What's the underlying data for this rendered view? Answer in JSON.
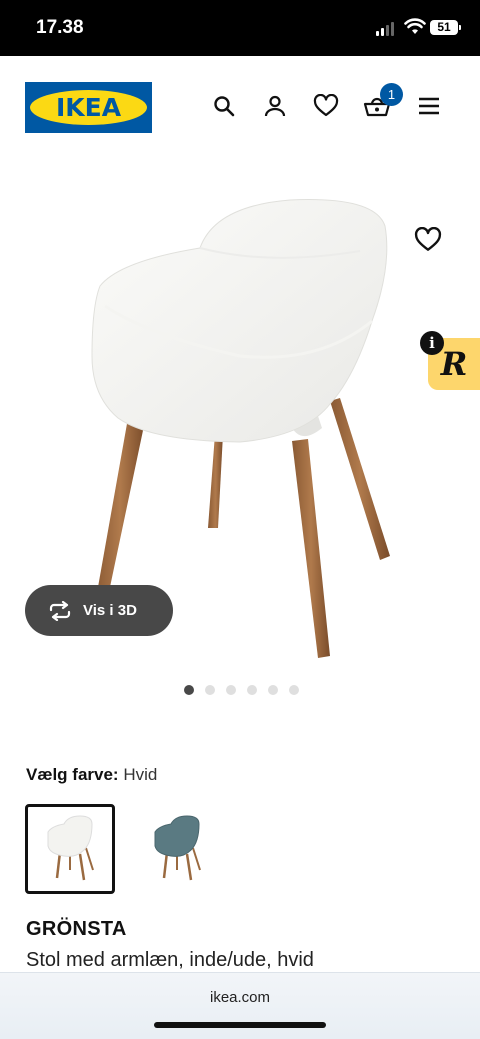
{
  "status_bar": {
    "time": "17.38",
    "battery": "51"
  },
  "header": {
    "logo_text": "IKEA",
    "cart_count": "1",
    "icons": [
      "search-icon",
      "profile-icon",
      "heart-icon",
      "basket-icon",
      "menu-icon"
    ]
  },
  "gallery": {
    "view_3d_label": "Vis i 3D",
    "dot_count": 6,
    "active_dot": 0
  },
  "color_selector": {
    "label": "Vælg farve:",
    "value": "Hvid",
    "options": [
      "Hvid",
      "Blå"
    ]
  },
  "product": {
    "name": "GRÖNSTA",
    "description": "Stol med armlæn, inde/ude, hvid"
  },
  "browser": {
    "url": "ikea.com"
  },
  "colors": {
    "ikea_blue": "#0058a3",
    "ikea_yellow": "#fbd914",
    "badge_yellow": "#fdd66c"
  }
}
